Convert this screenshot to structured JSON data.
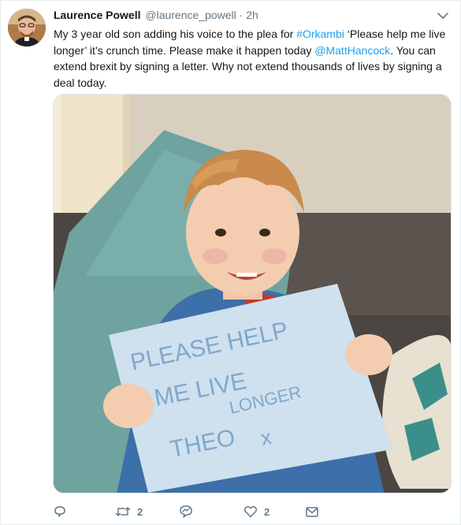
{
  "tweet": {
    "author_name": "Laurence Powell",
    "author_handle": "@laurence_powell",
    "separator": "·",
    "time": "2h",
    "text_parts": {
      "t1": "My 3 year old son adding his voice to the plea for ",
      "hashtag": "#Orkambi",
      "t2": " ‘Please help me live longer’ it’s crunch time. Please make it happen today ",
      "mention": "@MattHancock",
      "t3": ". You can extend brexit by signing a letter. Why not extend thousands of lives by signing a deal today."
    },
    "sign_text": {
      "line1": "PLEASE HELP",
      "line2": "ME LIVE",
      "line3": "LONGER",
      "line4": "THEO",
      "line5": "x"
    }
  },
  "actions": {
    "reply": {
      "icon": "reply-icon",
      "count": ""
    },
    "retweet": {
      "icon": "retweet-icon",
      "count": "2"
    },
    "dm_reply": {
      "icon": "direct-message-icon",
      "count": ""
    },
    "like": {
      "icon": "heart-icon",
      "count": "2"
    },
    "share": {
      "icon": "envelope-icon",
      "count": ""
    }
  },
  "colors": {
    "link": "#1da1f2",
    "muted": "#657786",
    "text": "#14171a"
  }
}
